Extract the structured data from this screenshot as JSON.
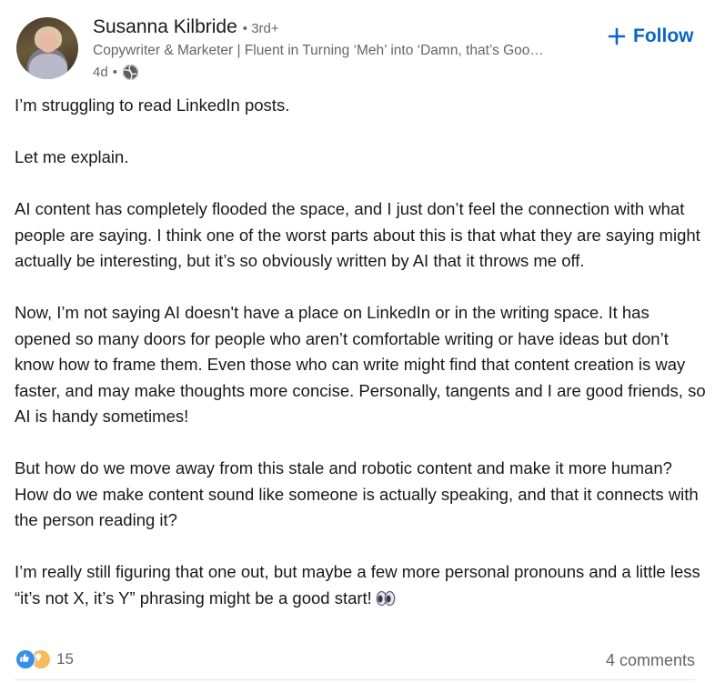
{
  "post": {
    "author": {
      "name": "Susanna Kilbride",
      "degree": "• 3rd+",
      "headline": "Copywriter & Marketer | Fluent in Turning ‘Meh’ into ‘Damn, that’s Goo…",
      "time": "4d",
      "meta_separator": "•",
      "visibility_icon": "globe-icon",
      "avatar_icon": "profile-photo"
    },
    "follow_label": "Follow",
    "follow_icon": "plus-icon",
    "accent_color": "#0a66c2",
    "paragraphs": [
      "I’m struggling to read LinkedIn posts.",
      "Let me explain.",
      "AI content has completely flooded the space, and I just don’t feel the connection with what people are saying. I think one of the worst parts about this is that what they are saying might actually be interesting, but it’s so obviously written by AI that it throws me off.",
      "Now, I’m not saying AI doesn't have a place on LinkedIn or in the writing space. It has opened so many doors for people who aren’t comfortable writing or have ideas but don’t know how to frame them. Even those who can write might find that content creation is way faster, and may make thoughts more concise. Personally, tangents and I are good friends, so AI is handy sometimes!",
      "But how do we move away from this stale and robotic content and make it more human? How do we make content sound like someone is actually speaking, and that it connects with the person reading it?",
      "I’m really still figuring that one out, but maybe a few more personal pronouns and a little less “it’s not X, it’s Y” phrasing might be a good start!"
    ],
    "trailing_emoji": "eyes-icon",
    "reactions": {
      "icons": [
        "like-icon",
        "insightful-icon"
      ],
      "count": "15"
    },
    "comments_label": "4 comments"
  }
}
